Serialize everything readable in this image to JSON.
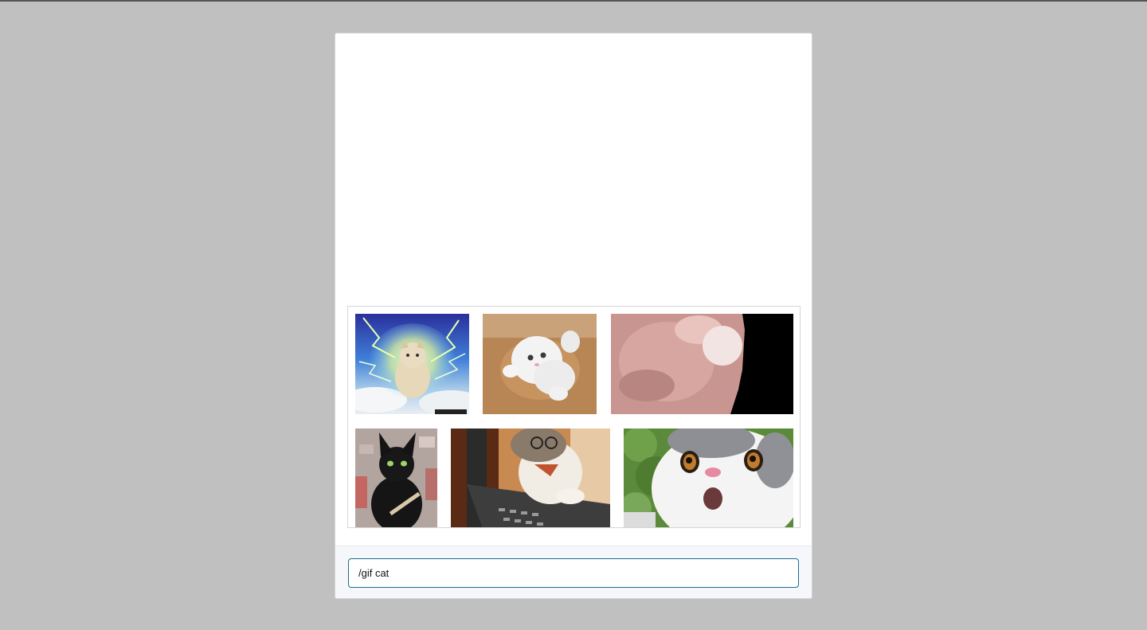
{
  "composer": {
    "input_value": "/gif cat"
  },
  "gif_results": [
    {
      "name": "gif-result-lightning-kitten"
    },
    {
      "name": "gif-result-white-cat-rolling"
    },
    {
      "name": "gif-result-closeup-nose"
    },
    {
      "name": "gif-result-black-cat-nail-file"
    },
    {
      "name": "gif-result-cat-laptop-glasses"
    },
    {
      "name": "gif-result-gray-cat-surprised"
    }
  ]
}
